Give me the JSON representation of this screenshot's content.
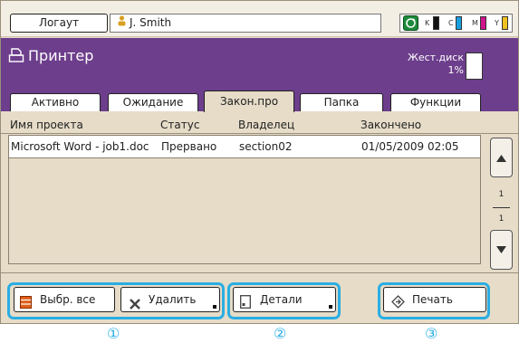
{
  "topbar": {
    "logout_label": "Логаут",
    "user_name": "J. Smith",
    "ink": [
      {
        "letter": "K",
        "color": "#111111"
      },
      {
        "letter": "C",
        "color": "#1aa0e0"
      },
      {
        "letter": "M",
        "color": "#d0148c"
      },
      {
        "letter": "Y",
        "color": "#f0c020"
      }
    ]
  },
  "header": {
    "title": "Принтер",
    "disk_label": "Жест.диск",
    "disk_percent": "1%"
  },
  "tabs": [
    {
      "label": "Активно",
      "active": false
    },
    {
      "label": "Ожидание",
      "active": false
    },
    {
      "label": "Закон.про",
      "active": true
    },
    {
      "label": "Папка",
      "active": false
    },
    {
      "label": "Функции",
      "active": false
    }
  ],
  "table": {
    "columns": [
      "Имя проекта",
      "Статус",
      "Владелец",
      "Закончено"
    ],
    "rows": [
      [
        "Microsoft Word - job1.doc",
        "Прервано",
        "section02",
        "01/05/2009 02:05"
      ]
    ]
  },
  "pager": {
    "current": "1",
    "total": "1"
  },
  "toolbar": {
    "select_all_label": "Выбр. все",
    "delete_label": "Удалить",
    "details_label": "Детали",
    "print_label": "Печать"
  },
  "callouts": [
    "①",
    "②",
    "③"
  ],
  "colors": {
    "accent_purple": "#6d3e8c",
    "highlight_blue": "#2aaee3",
    "panel_bg": "#e6dcc8"
  }
}
